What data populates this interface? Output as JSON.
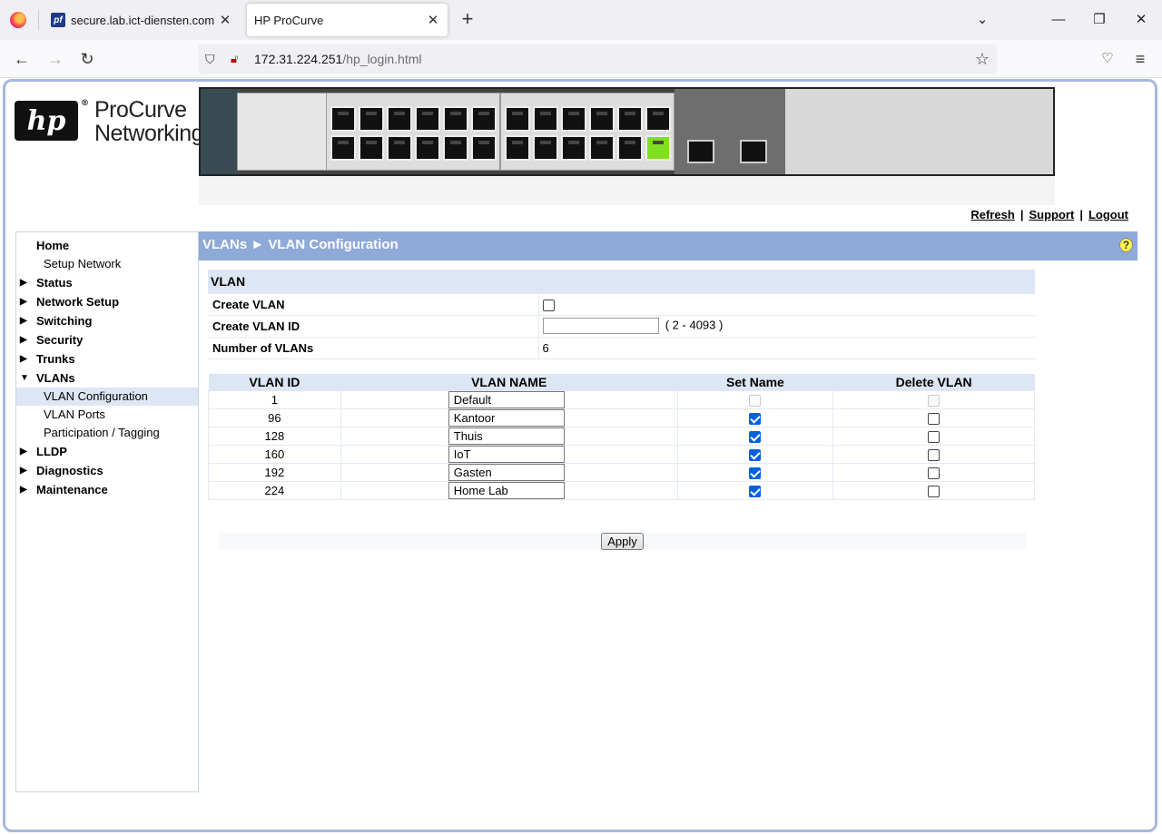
{
  "browser": {
    "tabs": [
      {
        "title": "secure.lab.ict-diensten.com - St",
        "favicon": "pf"
      },
      {
        "title": "HP ProCurve"
      }
    ],
    "url_host": "172.31.224.251",
    "url_path": "/hp_login.html"
  },
  "header": {
    "logo_mark": "hp",
    "brand_line1": "ProCurve",
    "brand_line2": "Networking",
    "links": [
      "Refresh",
      "Support",
      "Logout"
    ],
    "link_separator": "|"
  },
  "sidebar": {
    "items": [
      {
        "label": "Home",
        "expanded": true,
        "children": [
          "Setup Network"
        ]
      },
      {
        "label": "Status",
        "expanded": false
      },
      {
        "label": "Network Setup",
        "expanded": false
      },
      {
        "label": "Switching",
        "expanded": false
      },
      {
        "label": "Security",
        "expanded": false
      },
      {
        "label": "Trunks",
        "expanded": false
      },
      {
        "label": "VLANs",
        "expanded": true,
        "children": [
          "VLAN Configuration",
          "VLAN Ports",
          "Participation / Tagging"
        ],
        "selected": "VLAN Configuration"
      },
      {
        "label": "LLDP",
        "expanded": false
      },
      {
        "label": "Diagnostics",
        "expanded": false
      },
      {
        "label": "Maintenance",
        "expanded": false
      }
    ]
  },
  "breadcrumb": "VLANs ► VLAN Configuration",
  "vlan_section": {
    "title": "VLAN",
    "create_vlan_label": "Create VLAN",
    "create_vlan_id_label": "Create VLAN ID",
    "create_vlan_id_value": "",
    "create_vlan_id_range": "( 2 - 4093 )",
    "number_label": "Number of VLANs",
    "number_value": "6"
  },
  "vlan_table": {
    "columns": [
      "VLAN ID",
      "VLAN NAME",
      "Set Name",
      "Delete VLAN"
    ],
    "rows": [
      {
        "id": "1",
        "name": "Default",
        "set_name": false,
        "set_disabled": true,
        "delete": false,
        "delete_disabled": true
      },
      {
        "id": "96",
        "name": "Kantoor",
        "set_name": true,
        "delete": false
      },
      {
        "id": "128",
        "name": "Thuis",
        "set_name": true,
        "delete": false
      },
      {
        "id": "160",
        "name": "IoT",
        "set_name": true,
        "delete": false
      },
      {
        "id": "192",
        "name": "Gasten",
        "set_name": true,
        "delete": false
      },
      {
        "id": "224",
        "name": "Home Lab",
        "set_name": true,
        "delete": false
      }
    ]
  },
  "apply_label": "Apply",
  "colors": {
    "breadcrumb_bg": "#8fa9d8",
    "table_header_bg": "#dce6f4",
    "selected_nav_bg": "#dde6f4",
    "checkbox_checked": "#0061e0"
  }
}
